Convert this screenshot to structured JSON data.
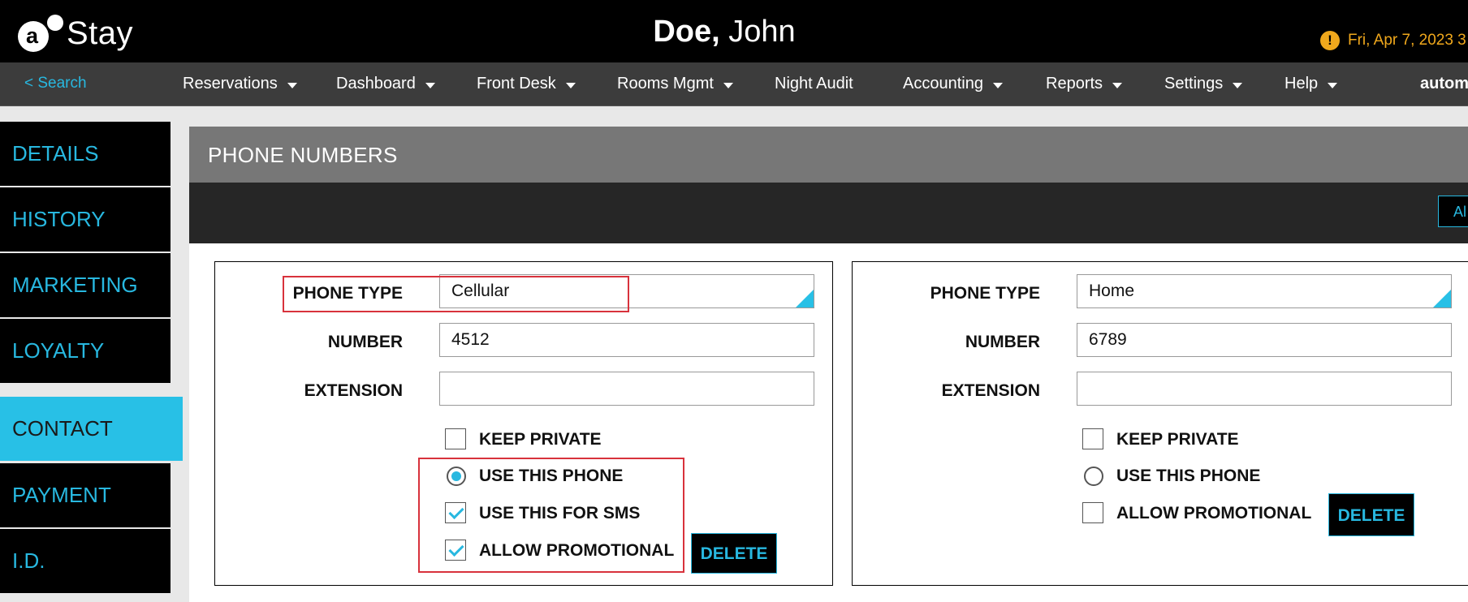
{
  "header": {
    "logo_text": "Stay",
    "logo_letter": "a",
    "guest_last": "Doe,",
    "guest_first": "John",
    "warning_glyph": "!",
    "datetime": "Fri, Apr 7, 2023 3"
  },
  "nav": {
    "search": "< Search",
    "items": [
      {
        "label": "Reservations",
        "dropdown": true
      },
      {
        "label": "Dashboard",
        "dropdown": true
      },
      {
        "label": "Front Desk",
        "dropdown": true
      },
      {
        "label": "Rooms Mgmt",
        "dropdown": true
      },
      {
        "label": "Night Audit",
        "dropdown": false
      },
      {
        "label": "Accounting",
        "dropdown": true
      },
      {
        "label": "Reports",
        "dropdown": true
      },
      {
        "label": "Settings",
        "dropdown": true
      },
      {
        "label": "Help",
        "dropdown": true
      }
    ],
    "user": "automa"
  },
  "sidebar": {
    "items": [
      "DETAILS",
      "HISTORY",
      "MARKETING",
      "LOYALTY",
      "CONTACT",
      "PAYMENT",
      "I.D."
    ],
    "active": "CONTACT"
  },
  "panel": {
    "title": "PHONE NUMBERS",
    "add_button": "Al"
  },
  "phones": [
    {
      "type_label": "PHONE TYPE",
      "type_value": "Cellular",
      "number_label": "NUMBER",
      "number_value": "4512",
      "extension_label": "EXTENSION",
      "extension_value": "",
      "keep_private_label": "KEEP PRIVATE",
      "keep_private": false,
      "use_phone_label": "USE THIS PHONE",
      "use_phone": true,
      "sms_label": "USE THIS FOR SMS",
      "sms": true,
      "promo_label": "ALLOW PROMOTIONAL",
      "promo": true,
      "delete_label": "DELETE"
    },
    {
      "type_label": "PHONE TYPE",
      "type_value": "Home",
      "number_label": "NUMBER",
      "number_value": "6789",
      "extension_label": "EXTENSION",
      "extension_value": "",
      "keep_private_label": "KEEP PRIVATE",
      "keep_private": false,
      "use_phone_label": "USE THIS PHONE",
      "use_phone": false,
      "promo_label": "ALLOW PROMOTIONAL",
      "promo": false,
      "delete_label": "DELETE"
    }
  ],
  "colors": {
    "accent": "#28c0e6",
    "highlight_box": "#d8323c",
    "warning": "#f0a81c"
  }
}
